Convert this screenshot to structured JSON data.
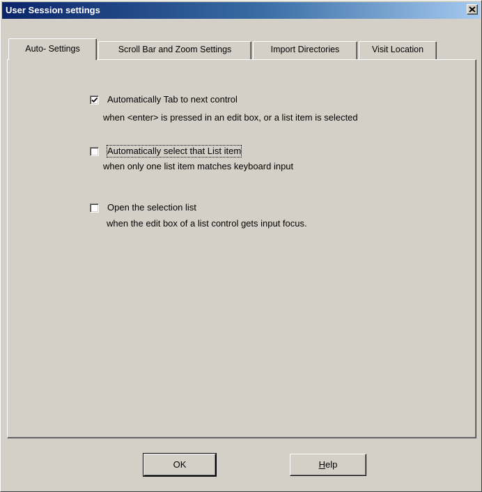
{
  "window": {
    "title": "User Session settings",
    "close_glyph": "✕"
  },
  "tabs": [
    {
      "label": "Auto- Settings",
      "active": true
    },
    {
      "label": "Scroll Bar and Zoom Settings",
      "active": false
    },
    {
      "label": "Import Directories",
      "active": false
    },
    {
      "label": "Visit Location",
      "active": false
    }
  ],
  "options": [
    {
      "label": "Automatically Tab to next control",
      "description": "when <enter> is pressed in an edit box, or a list item is selected",
      "checked": true
    },
    {
      "label": "Automatically select that List item",
      "description": "when only one list item matches keyboard input",
      "checked": false
    },
    {
      "label": "Open the selection list",
      "description": "when the edit box of a list control gets input focus.",
      "checked": false
    }
  ],
  "buttons": {
    "ok_label": "OK",
    "help_label_first": "H",
    "help_label_rest": "elp"
  },
  "icons": {
    "close": "close-icon",
    "checkmark": "checkmark-icon"
  }
}
